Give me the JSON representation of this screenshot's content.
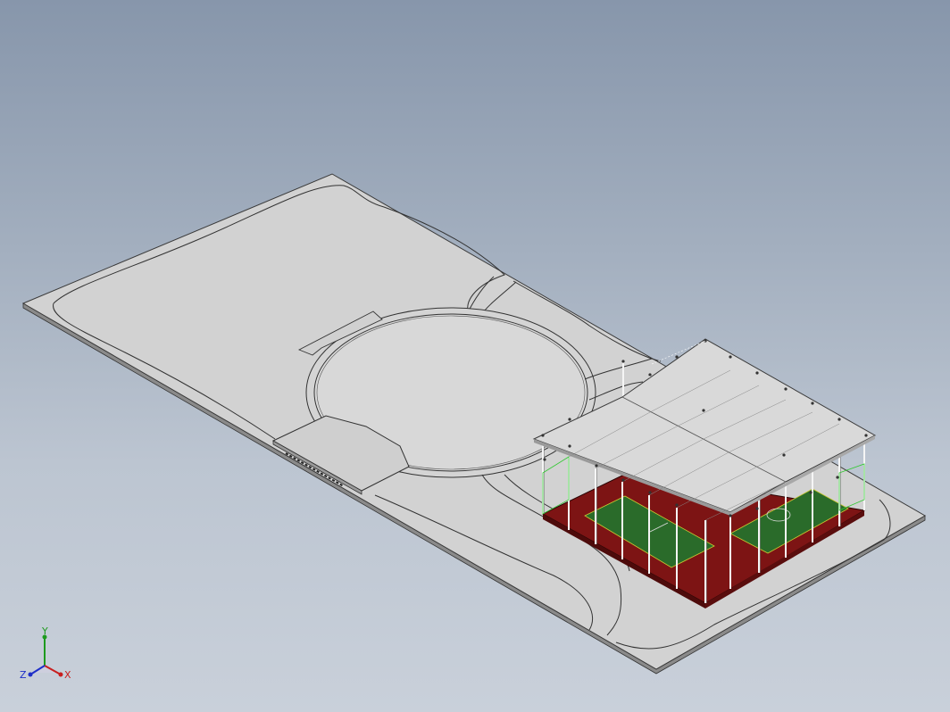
{
  "view": {
    "type": "CAD isometric model view",
    "background": {
      "top": "#8796ab",
      "bottom": "#c9d0da"
    }
  },
  "colors": {
    "ground": "#d2d2d2",
    "ground_edge": "#3a3a3a",
    "court_red": "#7d1414",
    "court_green": "#2a6b2a",
    "roof": "#d6d6d6",
    "column": "#f0f0f0"
  },
  "triad": {
    "x_label": "X",
    "y_label": "Y",
    "z_label": "Z",
    "x_color": "#c81e1e",
    "y_color": "#1e9a1e",
    "z_color": "#1e2ec8"
  }
}
